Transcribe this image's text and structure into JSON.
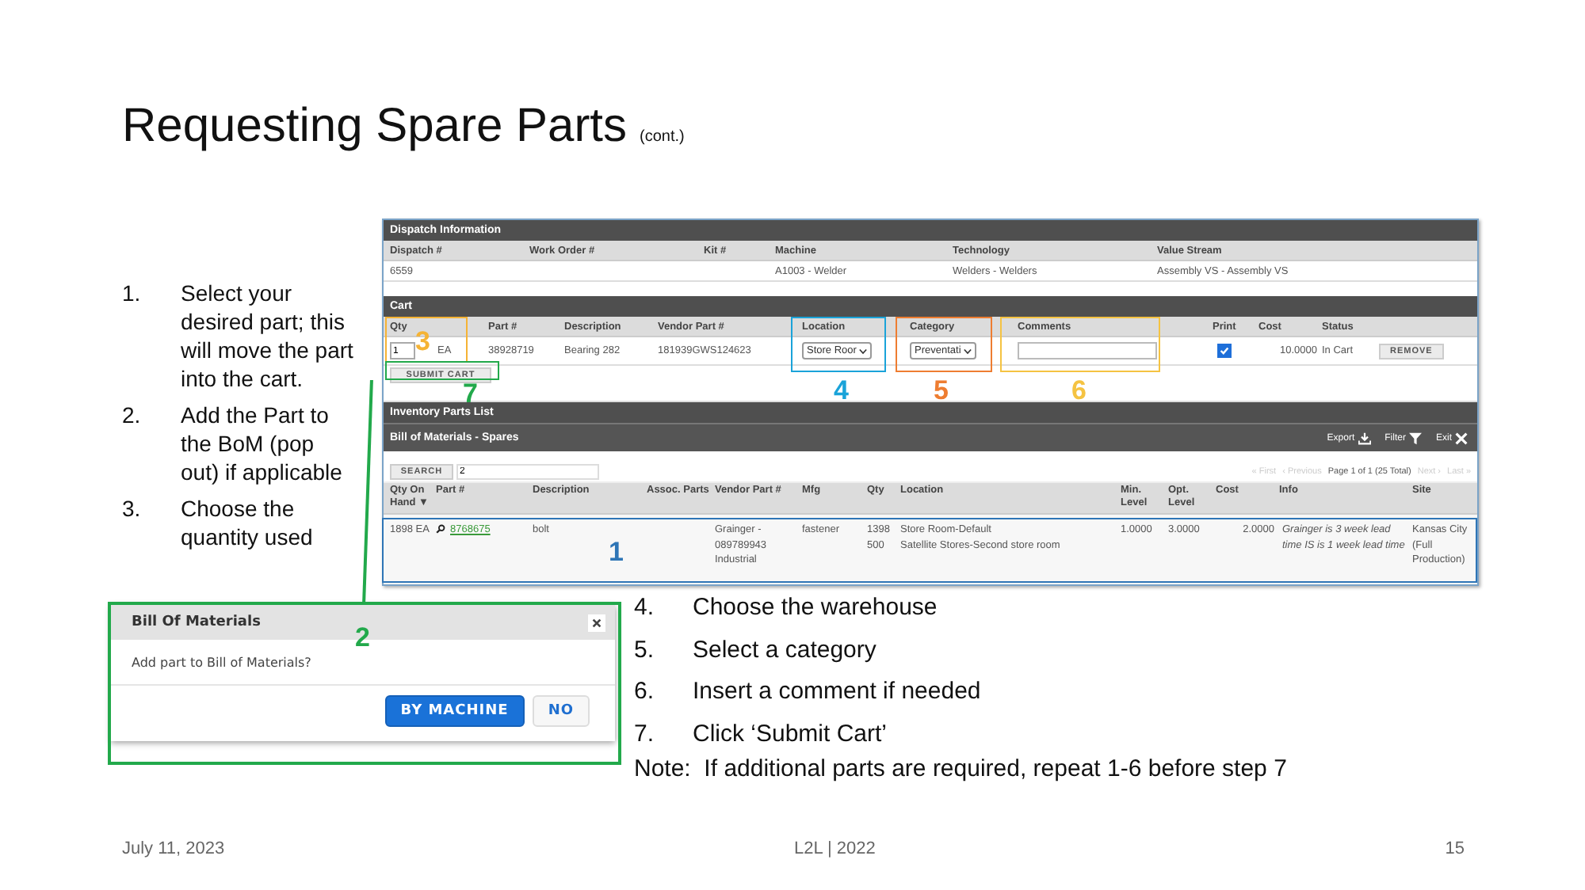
{
  "slide": {
    "title": "Requesting Spare Parts",
    "title_note": "(cont.)"
  },
  "steps_left": [
    {
      "number": "1.",
      "text": "Select your desired part; this will move the part into the cart."
    },
    {
      "number": "2.",
      "text": "Add the Part to the BoM (pop out) if applicable"
    },
    {
      "number": "3.",
      "text": "Choose the quantity used"
    }
  ],
  "app": {
    "dispatch": {
      "title": "Dispatch Information",
      "columns": [
        "Dispatch #",
        "Work Order #",
        "Kit #",
        "Machine",
        "Technology",
        "Value Stream"
      ],
      "values": {
        "dispatch": "6559",
        "machine": "A1003 - Welder",
        "technology": "Welders - Welders",
        "value_stream": "Assembly VS - Assembly VS"
      }
    },
    "cart": {
      "title": "Cart",
      "columns": [
        "Qty",
        "Part #",
        "Description",
        "Vendor Part #",
        "Location",
        "Category",
        "Comments",
        "Print",
        "Cost",
        "Status"
      ],
      "row": [
        {
          "kind": "qty",
          "value": "1",
          "unit": "EA"
        },
        {
          "kind": "text",
          "value": "38928719"
        },
        {
          "kind": "text",
          "value": "Bearing 282"
        },
        {
          "kind": "text",
          "value": "181939GWS124623"
        },
        {
          "kind": "select",
          "value": "Store Roor"
        },
        {
          "kind": "select",
          "value": "Preventati"
        },
        {
          "kind": "input"
        },
        {
          "kind": "checkbox",
          "checked": true
        },
        {
          "kind": "number",
          "value": "10.0000"
        },
        {
          "kind": "text",
          "value": "In Cart"
        },
        {
          "kind": "button",
          "value": "REMOVE"
        }
      ],
      "submit": "SUBMIT CART"
    },
    "inventory": {
      "title": "Inventory Parts List",
      "subtitle": "Bill of Materials - Spares",
      "actions": [
        {
          "kind": "export",
          "label": "Export"
        },
        {
          "kind": "filter",
          "label": "Filter"
        },
        {
          "kind": "exit",
          "label": "Exit"
        }
      ],
      "search": {
        "button": "SEARCH",
        "value": "2"
      },
      "pager": [
        {
          "text": "« First",
          "disabled": true
        },
        {
          "text": "‹ Previous",
          "disabled": true
        },
        {
          "text": "Page 1 of 1 (25 Total)",
          "disabled": false
        },
        {
          "text": "Next ›",
          "disabled": true
        },
        {
          "text": "Last »",
          "disabled": true
        }
      ],
      "columns": [
        "Qty On Hand ▼",
        "Part #",
        "Description",
        "Assoc. Parts",
        "Vendor Part #",
        "Mfg",
        "Qty",
        "Location",
        "Min. Level",
        "Opt. Level",
        "Cost",
        "Info",
        "Site"
      ],
      "rows": [
        {
          "qty_on_hand": "1898 EA",
          "part": "8768675",
          "description": "bolt",
          "vendor_part": "Grainger - 089789943 Industrial",
          "mfg": "fastener",
          "qty": [
            "1398",
            "500"
          ],
          "location": [
            "Store Room-Default",
            "Satellite Stores-Second store room"
          ],
          "min_level": "1.0000",
          "opt_level": "3.0000",
          "cost": "2.0000",
          "info": "Grainger is 3 week lead time IS is 1 week lead time",
          "site": "Kansas City (Full Production)"
        }
      ]
    }
  },
  "dialog": {
    "title": "Bill Of Materials",
    "message": "Add part to Bill of Materials?",
    "buttons": [
      {
        "label": "BY MACHINE",
        "primary": true
      },
      {
        "label": "NO",
        "primary": false
      }
    ]
  },
  "callouts": [
    {
      "number": "3",
      "color": "#f5b335",
      "leader": false
    },
    {
      "number": "7",
      "color": "#22a94b",
      "leader": false
    },
    {
      "number": "4",
      "color": "#1aa3d9",
      "leader": false
    },
    {
      "number": "5",
      "color": "#ee7d31",
      "leader": false
    },
    {
      "number": "6",
      "color": "#f5c342",
      "leader": false
    },
    {
      "number": "1",
      "color": "#2e75b6",
      "leader": false
    },
    {
      "number": "2",
      "color": "#22a94b",
      "leader": true
    }
  ],
  "steps_right": [
    {
      "number": "4.",
      "text": "Choose the warehouse"
    },
    {
      "number": "5.",
      "text": "Select a category"
    },
    {
      "number": "6.",
      "text": "Insert a comment if needed"
    },
    {
      "number": "7.",
      "text": "Click ‘Submit Cart’"
    }
  ],
  "note": "Note:  If additional parts are required, repeat 1-6 before step 7",
  "footer": {
    "date": "July 11, 2023",
    "center": "L2L | 2022",
    "page": "15"
  }
}
